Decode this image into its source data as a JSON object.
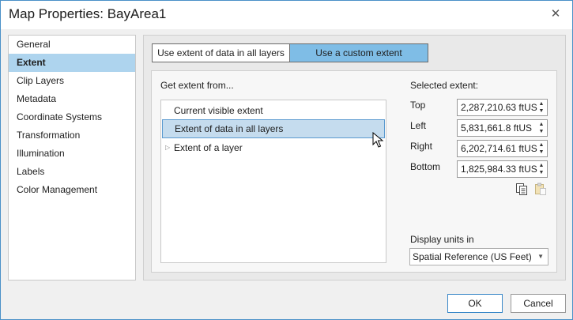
{
  "window": {
    "title": "Map Properties: BayArea1",
    "close_glyph": "✕"
  },
  "nav": {
    "items": [
      {
        "label": "General"
      },
      {
        "label": "Extent"
      },
      {
        "label": "Clip Layers"
      },
      {
        "label": "Metadata"
      },
      {
        "label": "Coordinate Systems"
      },
      {
        "label": "Transformation"
      },
      {
        "label": "Illumination"
      },
      {
        "label": "Labels"
      },
      {
        "label": "Color Management"
      }
    ],
    "selected": "Extent"
  },
  "segmented": {
    "option_all": "Use extent of data in all layers",
    "option_custom": "Use a custom extent",
    "selected": "Use a custom extent"
  },
  "extent_source": {
    "label": "Get extent from...",
    "items": [
      {
        "label": "Current visible extent"
      },
      {
        "label": "Extent of data in all layers"
      },
      {
        "label": "Extent of a layer"
      }
    ],
    "selected": "Extent of data in all layers"
  },
  "selected_extent": {
    "label": "Selected extent:",
    "top": {
      "label": "Top",
      "value": "2,287,210.63 ftUS"
    },
    "left": {
      "label": "Left",
      "value": "5,831,661.8 ftUS"
    },
    "right": {
      "label": "Right",
      "value": "6,202,714.61 ftUS"
    },
    "bottom": {
      "label": "Bottom",
      "value": "1,825,984.33 ftUS"
    },
    "copy_icon": "copy-icon",
    "paste_icon": "paste-icon"
  },
  "display_units": {
    "label": "Display units in",
    "value": "Spatial Reference (US Feet)"
  },
  "buttons": {
    "ok": "OK",
    "cancel": "Cancel"
  },
  "colors": {
    "accent": "#7fbde6",
    "nav_selected": "#aed4ee",
    "list_selected": "#c5dcee",
    "border_focus": "#3a88c8"
  }
}
